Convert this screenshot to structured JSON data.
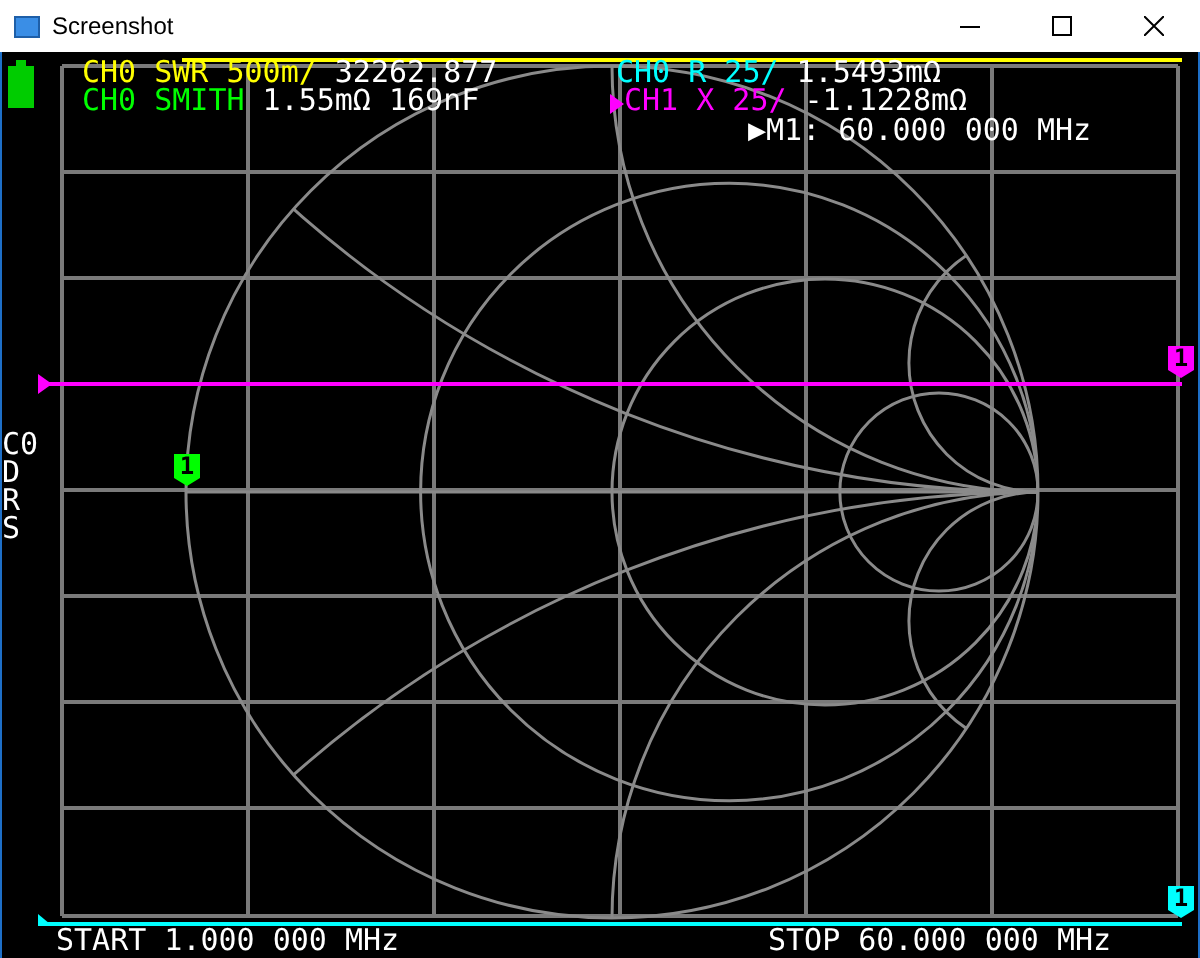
{
  "window": {
    "title": "Screenshot"
  },
  "traces": [
    {
      "label": "CH0 SWR 500m/",
      "value": "32262.877",
      "color": "#ffff00",
      "active": false
    },
    {
      "label": "CH0 SMITH",
      "value": "1.55mΩ 169nF",
      "color": "#00ff00",
      "active": false
    },
    {
      "label": "CH0 R 25/",
      "value": "1.5493mΩ",
      "color": "#00ffff",
      "active": false
    },
    {
      "label": "CH1 X 25/",
      "value": "-1.1228mΩ",
      "color": "#ff00ff",
      "active": true
    }
  ],
  "marker_readout": "▶M1: 60.000 000 MHz",
  "side_menu": [
    "C0",
    "D",
    "R",
    "S"
  ],
  "markers": [
    {
      "label": "1",
      "color": "#00ff00"
    },
    {
      "label": "1",
      "color": "#ff00ff"
    },
    {
      "label": "1",
      "color": "#00ffff"
    }
  ],
  "start": "START 1.000 000 MHz",
  "stop": "STOP 60.000 000 MHz"
}
